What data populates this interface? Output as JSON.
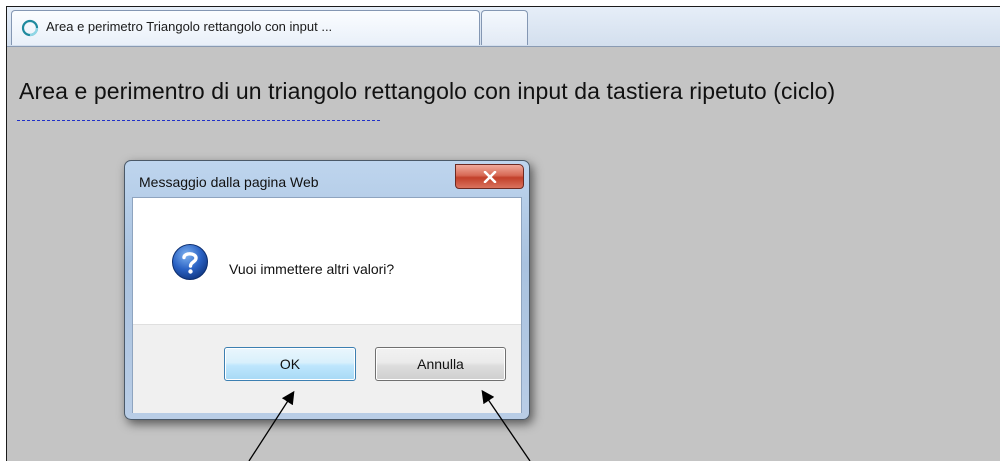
{
  "browser": {
    "active_tab": {
      "title": "Area e perimetro Triangolo rettangolo con input ...",
      "icon": "loading-ring-icon"
    },
    "new_tab": {
      "icon": "new-tab-icon"
    }
  },
  "page": {
    "heading": "Area e perimentro di un triangolo rettangolo con input da tastiera ripetuto (ciclo)"
  },
  "dialog": {
    "title": "Messaggio dalla pagina Web",
    "close_icon": "close-icon",
    "message_icon": "question-icon",
    "message": "Vuoi immettere altri valori?",
    "ok_label": "OK",
    "cancel_label": "Annulla"
  },
  "colors": {
    "page_background": "#c4c4c4",
    "heading_underline": "#2030c8",
    "ok_button_border": "#3c7fb1",
    "close_button": "#c2402a"
  }
}
